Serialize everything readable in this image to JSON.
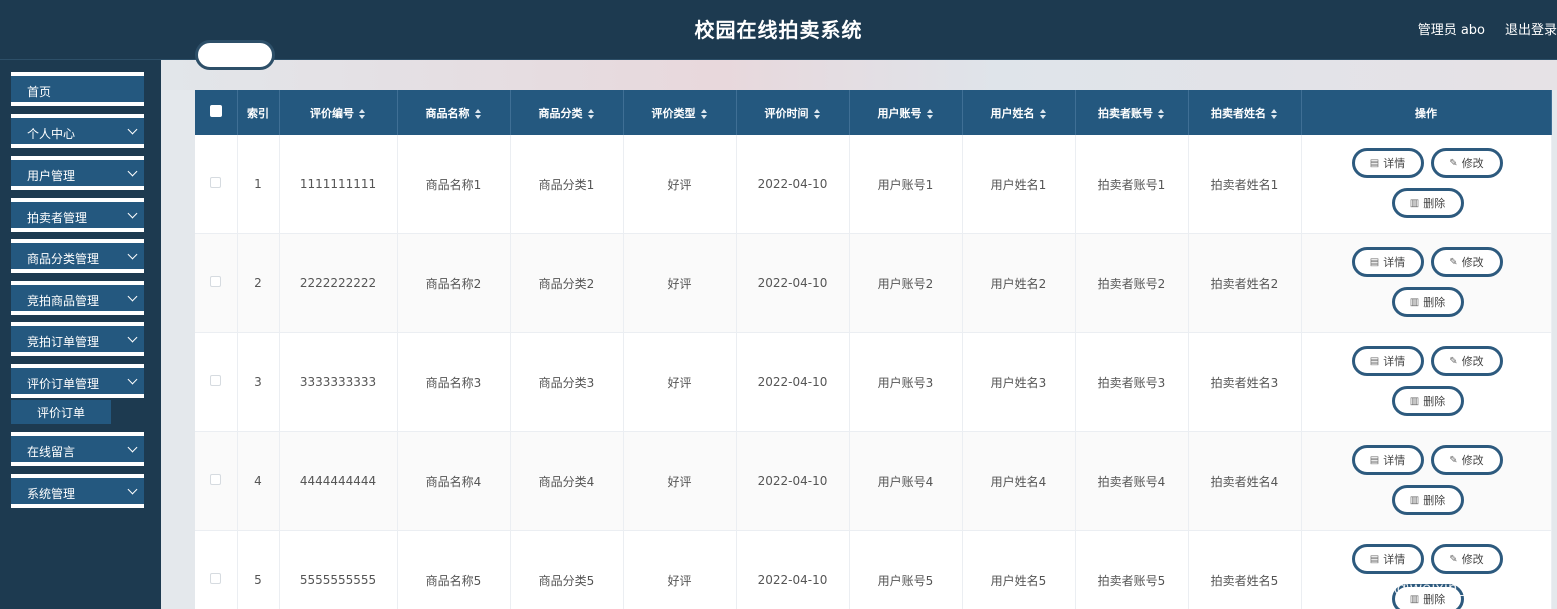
{
  "header": {
    "title": "校园在线拍卖系统",
    "admin": "管理员 abo",
    "logout": "退出登录"
  },
  "sidebar": {
    "items": [
      {
        "label": "首页",
        "chevron": false
      },
      {
        "label": "个人中心",
        "chevron": true
      },
      {
        "label": "用户管理",
        "chevron": true
      },
      {
        "label": "拍卖者管理",
        "chevron": true
      },
      {
        "label": "商品分类管理",
        "chevron": true
      },
      {
        "label": "竞拍商品管理",
        "chevron": true
      },
      {
        "label": "竞拍订单管理",
        "chevron": true
      },
      {
        "label": "评价订单管理",
        "chevron": true
      },
      {
        "label": "在线留言",
        "chevron": true
      },
      {
        "label": "系统管理",
        "chevron": true
      }
    ],
    "active_submenu": "评价订单"
  },
  "table": {
    "columns": [
      "索引",
      "评价编号",
      "商品名称",
      "商品分类",
      "评价类型",
      "评价时间",
      "用户账号",
      "用户姓名",
      "拍卖者账号",
      "拍卖者姓名",
      "操作"
    ],
    "actions": {
      "detail": "详情",
      "edit": "修改",
      "delete": "删除"
    },
    "rows": [
      [
        "1",
        "1111111111",
        "商品名称1",
        "商品分类1",
        "好评",
        "2022-04-10",
        "用户账号1",
        "用户姓名1",
        "拍卖者账号1",
        "拍卖者姓名1"
      ],
      [
        "2",
        "2222222222",
        "商品名称2",
        "商品分类2",
        "好评",
        "2022-04-10",
        "用户账号2",
        "用户姓名2",
        "拍卖者账号2",
        "拍卖者姓名2"
      ],
      [
        "3",
        "3333333333",
        "商品名称3",
        "商品分类3",
        "好评",
        "2022-04-10",
        "用户账号3",
        "用户姓名3",
        "拍卖者账号3",
        "拍卖者姓名3"
      ],
      [
        "4",
        "4444444444",
        "商品名称4",
        "商品分类4",
        "好评",
        "2022-04-10",
        "用户账号4",
        "用户姓名4",
        "拍卖者账号4",
        "拍卖者姓名4"
      ],
      [
        "5",
        "5555555555",
        "商品名称5",
        "商品分类5",
        "好评",
        "2022-04-10",
        "用户账号5",
        "用户姓名5",
        "拍卖者账号5",
        "拍卖者姓名5"
      ]
    ]
  },
  "watermark": "CSDN @weixin_72790115"
}
